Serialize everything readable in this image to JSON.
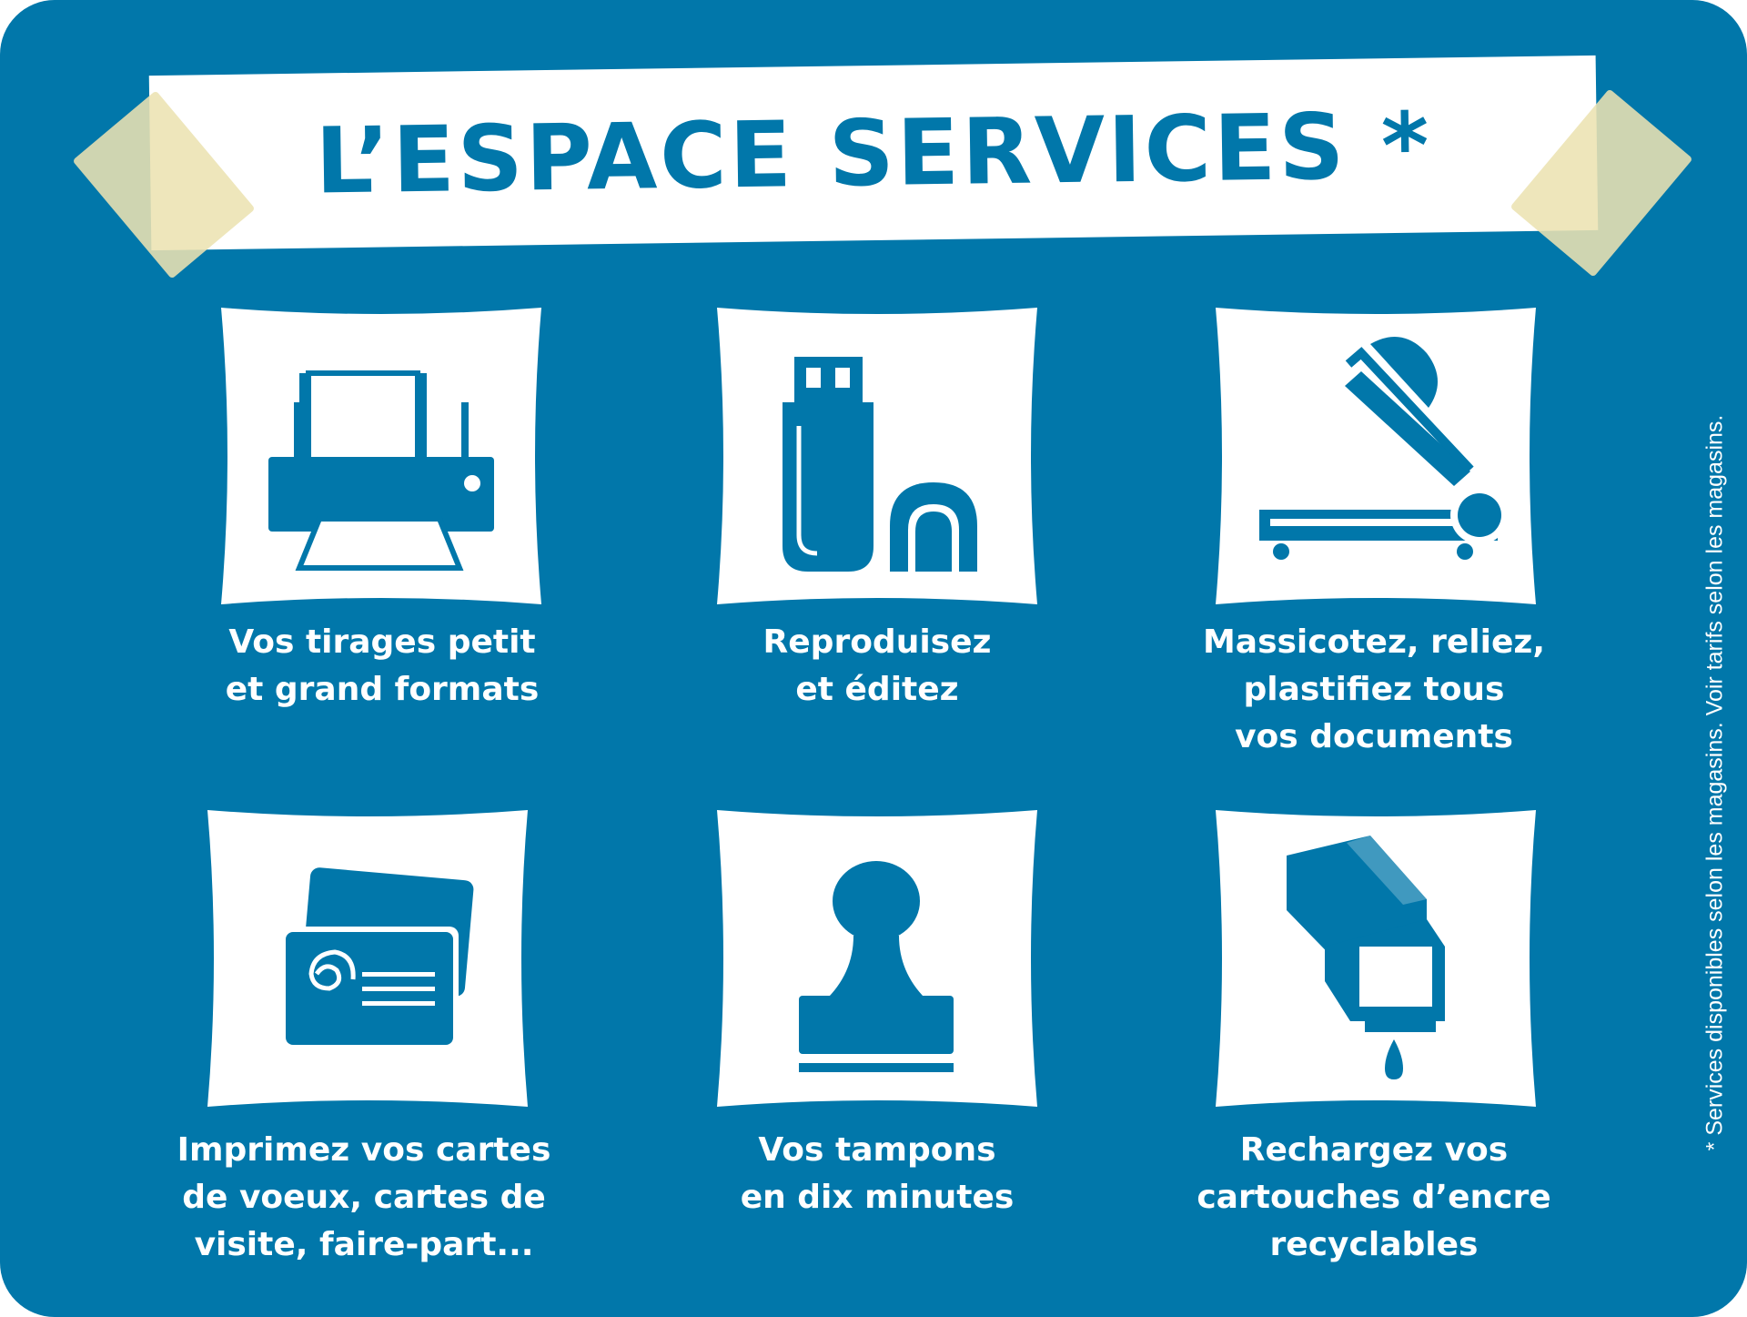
{
  "title": "L’ESPACE SERVICES *",
  "colors": {
    "background": "#0177aa",
    "card": "#ffffff",
    "icon": "#0177aa",
    "tape": "#ece2b2"
  },
  "services": [
    {
      "icon": "printer-icon",
      "lines": [
        "Vos tirages petit",
        "et grand formats"
      ]
    },
    {
      "icon": "usb-drive-icon",
      "lines": [
        "Reproduisez",
        "et éditez"
      ]
    },
    {
      "icon": "paper-cutter-icon",
      "lines": [
        "Massicotez, reliez,",
        "plastifiez tous",
        "vos documents"
      ]
    },
    {
      "icon": "business-cards-icon",
      "lines": [
        "Imprimez vos cartes",
        "de voeux, cartes de",
        "visite, faire-part..."
      ]
    },
    {
      "icon": "rubber-stamp-icon",
      "lines": [
        "Vos tampons",
        "en dix minutes"
      ]
    },
    {
      "icon": "ink-cartridge-icon",
      "lines": [
        "Rechargez vos",
        "cartouches d’encre",
        "recyclables"
      ]
    }
  ],
  "footnote": "* Services disponibles selon les magasins. Voir tarifs selon les magasins."
}
